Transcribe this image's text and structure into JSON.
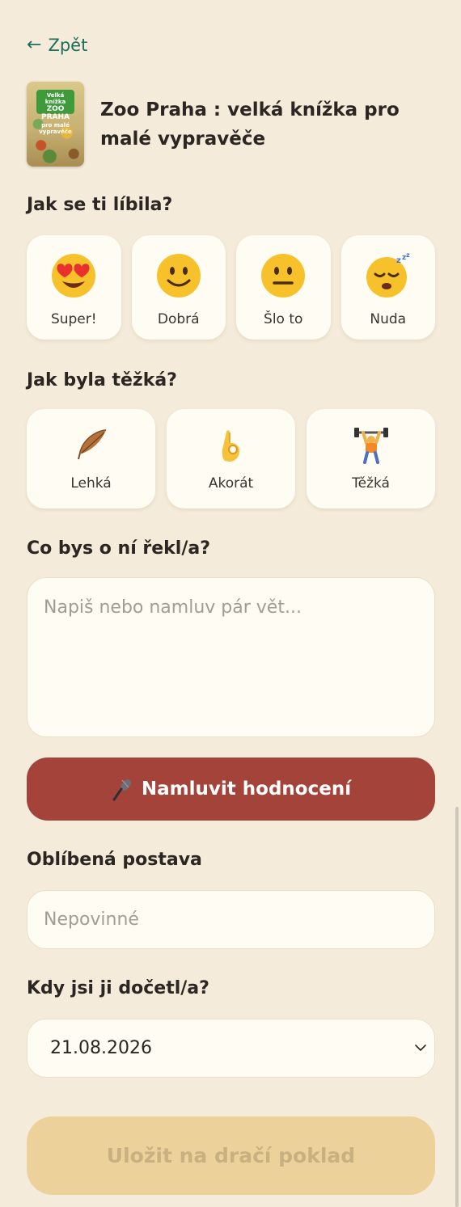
{
  "nav": {
    "back_label": "Zpět",
    "back_icon": "arrow-left-icon"
  },
  "book": {
    "title": "Zoo Praha : velká knížka pro malé vypravěče",
    "cover_line1": "Velká knížka",
    "cover_line2": "ZOO PRAHA",
    "cover_line3": "pro malé vypravěče"
  },
  "mood": {
    "question": "Jak se ti líbila?",
    "options": [
      {
        "label": "Super!",
        "icon": "heart-eyes-emoji-icon"
      },
      {
        "label": "Dobrá",
        "icon": "smiling-face-emoji-icon"
      },
      {
        "label": "Šlo to",
        "icon": "neutral-face-emoji-icon"
      },
      {
        "label": "Nuda",
        "icon": "sleeping-face-emoji-icon"
      }
    ]
  },
  "difficulty": {
    "question": "Jak byla těžká?",
    "options": [
      {
        "label": "Lehká",
        "icon": "feather-icon"
      },
      {
        "label": "Akorát",
        "icon": "ok-hand-icon"
      },
      {
        "label": "Těžká",
        "icon": "weightlifter-icon"
      }
    ]
  },
  "review": {
    "question": "Co bys o ní řekl/a?",
    "placeholder": "Napiš nebo namluv pár vět..."
  },
  "voice_button": {
    "label": "Namluvit hodnocení",
    "icon": "microphone-icon"
  },
  "character": {
    "label": "Oblíbená postava",
    "placeholder": "Nepovinné"
  },
  "finished": {
    "label": "Kdy jsi ji dočetl/a?",
    "value": "21.08.2026"
  },
  "save_button": {
    "label": "Uložit na dračí poklad"
  },
  "colors": {
    "background": "#f4ebda",
    "accent_green": "#1f6f5f",
    "voice_button": "#a4433a",
    "save_button_disabled": "#ecd19b"
  }
}
